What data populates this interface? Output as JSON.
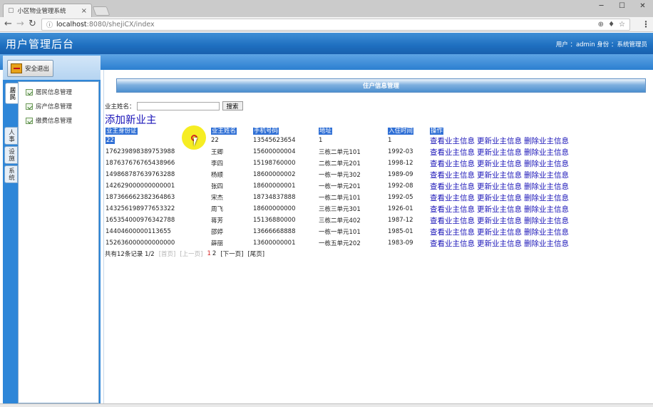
{
  "browser": {
    "tab_title": "小区物业管理系统",
    "url_host": "localhost",
    "url_rest": ":8080/shejiCX/index"
  },
  "header": {
    "title": "用户管理后台",
    "user_text": "用户 ：admin  身份 ：系统管理员"
  },
  "sidebar": {
    "logout_label": "安全退出",
    "vtabs": [
      "居民",
      "人事",
      "设施",
      "系统"
    ],
    "menu_items": [
      "居民信息管理",
      "房产信息管理",
      "缴费信息管理"
    ]
  },
  "main": {
    "section_title": "住户信息管理",
    "search_label": "业主姓名：",
    "search_placeholder": "",
    "search_button": "搜索",
    "add_link": "添加新业主",
    "columns": [
      "业主身份证",
      "业主姓名",
      "手机号码",
      "地址",
      "入住时间",
      "操作"
    ],
    "rows": [
      [
        "22",
        "22",
        "13545623654",
        "1",
        "1"
      ],
      [
        "176239898389753988",
        "王卿",
        "15600000004",
        "三栋二单元101",
        "1992-03"
      ],
      [
        "187637676765438966",
        "李四",
        "15198760000",
        "二栋二单元201",
        "1998-12"
      ],
      [
        "149868787639763288",
        "杨顺",
        "18600000002",
        "一栋一单元302",
        "1989-09"
      ],
      [
        "142629000000000001",
        "张四",
        "18600000001",
        "一栋一单元201",
        "1992-08"
      ],
      [
        "187366662382364863",
        "宋杰",
        "18734837888",
        "一栋二单元101",
        "1992-05"
      ],
      [
        "143256198977653322",
        "周飞",
        "18600000000",
        "三栋三单元301",
        "1926-01"
      ],
      [
        "165354000976342788",
        "蒋芳",
        "15136880000",
        "三栋二单元402",
        "1987-12"
      ],
      [
        "14404600000113655",
        "邵婷",
        "13666668888",
        "一栋一单元101",
        "1985-01"
      ],
      [
        "152636000000000000",
        "薛丽",
        "13600000001",
        "一栋五单元202",
        "1983-09"
      ]
    ],
    "ops": [
      "查看业主信息",
      "更新业主信息",
      "删除业主信息"
    ],
    "pager": {
      "summary": "共有12条记录  1/2",
      "first": "[首页]",
      "prev": "[上一页]",
      "page1": "1",
      "page2": "2",
      "next": "[下一页]",
      "last": "[尾页]"
    }
  }
}
